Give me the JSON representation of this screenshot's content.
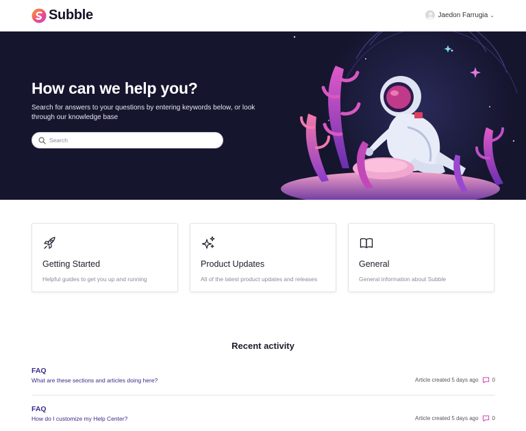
{
  "header": {
    "brand": "Subble",
    "user_name": "Jaedon Farrugia",
    "caret": "⌄"
  },
  "hero": {
    "title": "How can we help you?",
    "subtitle": "Search for answers to your questions by entering keywords below, or look through our knowledge base",
    "search_placeholder": "Search",
    "search_value": ""
  },
  "categories": [
    {
      "icon": "rocket-icon",
      "title": "Getting Started",
      "description": "Helpful guides to get you up and running"
    },
    {
      "icon": "sparkles-icon",
      "title": "Product Updates",
      "description": "All of the latest product updates and releases"
    },
    {
      "icon": "book-icon",
      "title": "General",
      "description": "General information about Subble"
    }
  ],
  "recent": {
    "title": "Recent activity",
    "items": [
      {
        "section": "FAQ",
        "article": "What are these sections and articles doing here?",
        "meta": "Article created 5 days ago",
        "comments": "0"
      },
      {
        "section": "FAQ",
        "article": "How do I customize my Help Center?",
        "meta": "Article created 5 days ago",
        "comments": "0"
      }
    ]
  },
  "colors": {
    "hero_bg": "#15152e",
    "link": "#3b2a8a",
    "accent_pink": "#d63fb0",
    "accent_orange": "#f5a623"
  }
}
